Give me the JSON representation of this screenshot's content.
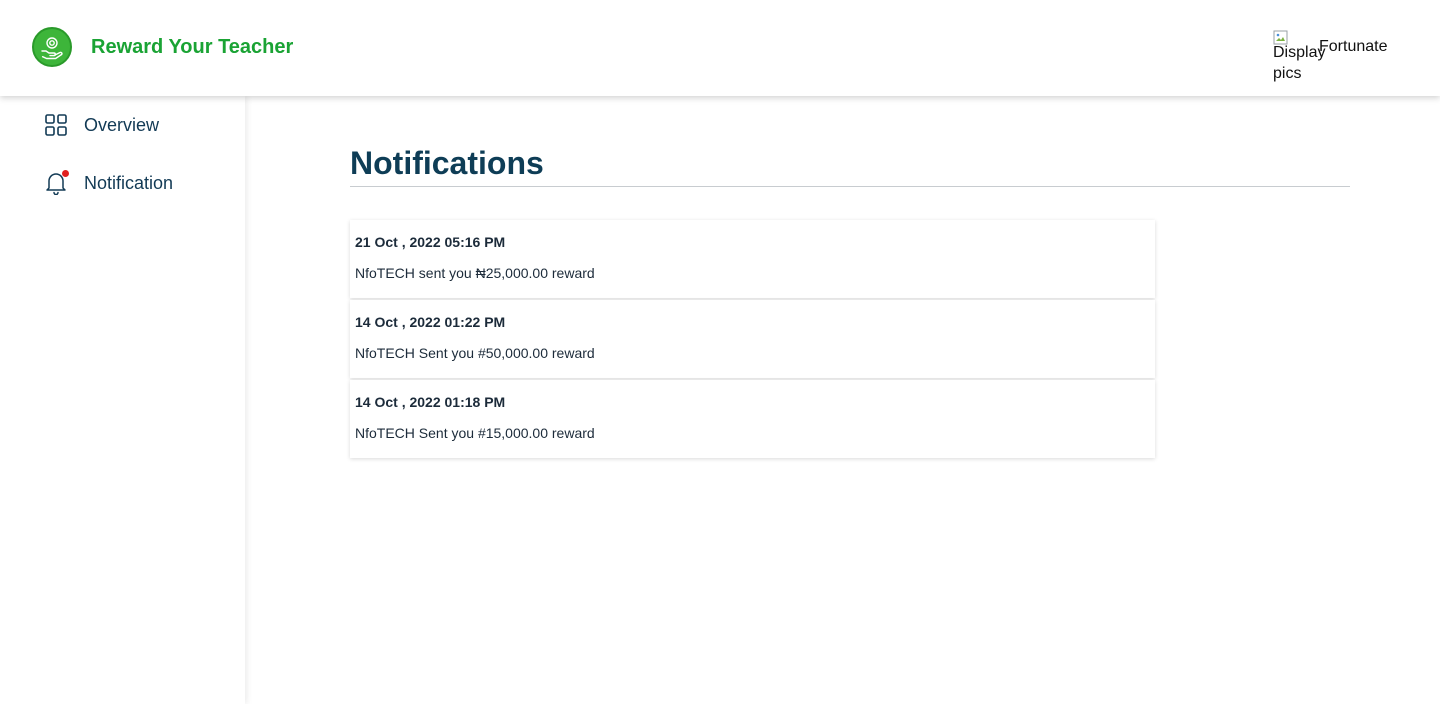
{
  "header": {
    "brand_name": "Reward Your Teacher",
    "user": {
      "avatar_alt": "Display pics",
      "name": "Fortunate"
    }
  },
  "sidebar": {
    "items": [
      {
        "label": "Overview",
        "icon": "grid-icon"
      },
      {
        "label": "Notification",
        "icon": "bell-icon",
        "has_unread_dot": true
      }
    ]
  },
  "main": {
    "title": "Notifications",
    "notifications": [
      {
        "date": "21 Oct , 2022 05:16 PM",
        "message": "NfoTECH sent you ₦25,000.00 reward"
      },
      {
        "date": "14 Oct , 2022 01:22 PM",
        "message": "NfoTECH Sent you #50,000.00 reward"
      },
      {
        "date": "14 Oct , 2022 01:18 PM",
        "message": "NfoTECH Sent you #15,000.00 reward"
      }
    ]
  },
  "colors": {
    "brand_green": "#1aa334",
    "title_navy": "#0e3d56",
    "notification_dot": "#e01f1f"
  }
}
